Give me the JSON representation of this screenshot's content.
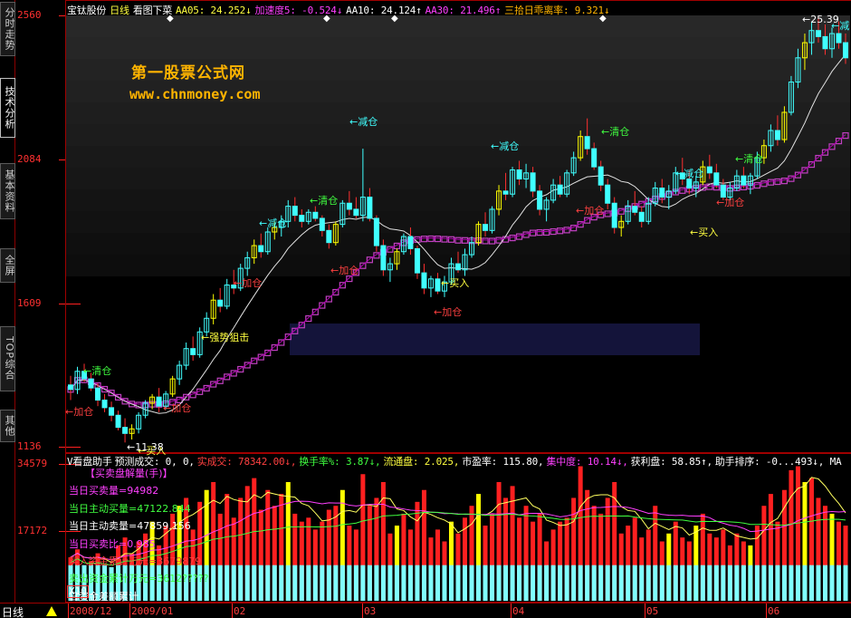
{
  "sidebar": {
    "tabs": [
      {
        "label": "分时走势",
        "active": false
      },
      {
        "label": "技术分析",
        "active": true
      },
      {
        "label": "基本资料",
        "active": false
      },
      {
        "label": "全屏",
        "active": false
      },
      {
        "label": "TOP综合",
        "active": false
      },
      {
        "label": "其他",
        "active": false
      }
    ]
  },
  "header": {
    "stock_name": "宝钛股份",
    "period": "日线",
    "indicator_name": "看图下菜",
    "items": [
      {
        "text": "AA05: 24.252↓",
        "color": "#ffff40"
      },
      {
        "text": "加速度5: -0.524↓",
        "color": "#ff40ff"
      },
      {
        "text": "AA10: 24.124↑",
        "color": "#ffffff"
      },
      {
        "text": "AA30: 21.496↑",
        "color": "#ff40ff"
      },
      {
        "text": "三拾日乖离率: 9.321↓",
        "color": "#ffb400"
      }
    ]
  },
  "watermark": {
    "line1": "第一股票公式网",
    "line2": "www.chnmoney.com"
  },
  "price_axis": {
    "labels": [
      "2560",
      "2084",
      "1609",
      "1136"
    ]
  },
  "volume_axis": {
    "labels": [
      "34579",
      "17172"
    ]
  },
  "annotations": [
    {
      "text": "←清仓",
      "color": "#40ff40"
    },
    {
      "text": "←加仓",
      "color": "#ff4040"
    },
    {
      "text": "←加仓",
      "color": "#ff4040"
    },
    {
      "text": "←买入",
      "color": "#ffff40"
    },
    {
      "text": "←强势狙击",
      "color": "#ffff40"
    },
    {
      "text": "←加仓",
      "color": "#ff4040"
    },
    {
      "text": "←减仓",
      "color": "#40ffff"
    },
    {
      "text": "←清仓",
      "color": "#40ff40"
    },
    {
      "text": "←加仓",
      "color": "#ff4040"
    },
    {
      "text": "←减仓",
      "color": "#40ffff"
    },
    {
      "text": "←买入",
      "color": "#ffff40"
    },
    {
      "text": "←加仓",
      "color": "#ff4040"
    },
    {
      "text": "←减仓",
      "color": "#40ffff"
    },
    {
      "text": "←清仓",
      "color": "#40ff40"
    },
    {
      "text": "←加仓",
      "color": "#ff4040"
    },
    {
      "text": "←减仓",
      "color": "#40ffff"
    },
    {
      "text": "←清仓",
      "color": "#40ff40"
    },
    {
      "text": "←加仓",
      "color": "#ff4040"
    },
    {
      "text": "←买入",
      "color": "#ffff40"
    },
    {
      "text": "←25.39",
      "color": "#ffffff"
    },
    {
      "text": "←减",
      "color": "#40ffff"
    },
    {
      "text": "←11.38",
      "color": "#ffffff"
    }
  ],
  "volume_header": {
    "title": "V看盘助手",
    "items": [
      {
        "text": "预测成交: 0, 0,",
        "color": "#ffffff"
      },
      {
        "text": "实成交: 78342.00↓,",
        "color": "#ff4040"
      },
      {
        "text": "换手率%: 3.87↓,",
        "color": "#40ff40"
      },
      {
        "text": "流通盘: 2.025,",
        "color": "#ffff40"
      },
      {
        "text": "市盈率: 115.80,",
        "color": "#ffffff"
      },
      {
        "text": "集中度: 10.14↓,",
        "color": "#ff40ff"
      },
      {
        "text": "获利盘: 58.85↑,",
        "color": "#ffffff"
      },
      {
        "text": "助手排序: -0...493↓, MA",
        "color": "#ffffff"
      }
    ]
  },
  "info_panel": {
    "title": "【买卖盘解量(手)】",
    "lines": [
      {
        "text": "当日买卖量=94982",
        "color": "#ff40ff"
      },
      {
        "text": "当日主动买量=47122.844",
        "color": "#40ff40"
      },
      {
        "text": "当日主动卖量=47859.156",
        "color": "#ffffff"
      },
      {
        "text": "当日买卖比=0.985",
        "color": "#ff40ff"
      },
      {
        "text": "买入资金累计万元=3679879",
        "color": "#ff4040"
      },
      {
        "text": "卖出资金累计万元=3612?????",
        "color": "#40ff40"
      },
      {
        "text": "日资金差额累计",
        "color": "#ffffff"
      }
    ]
  },
  "volume_scale": "X10",
  "timeline": {
    "period_label": "日线",
    "labels": [
      "2008/12",
      "2009/01",
      "02",
      "03",
      "04",
      "05",
      "06"
    ]
  },
  "chart_data": {
    "type": "candlestick",
    "price_range": [
      1136,
      2560
    ],
    "volume_range": [
      0,
      34579
    ],
    "candles": [
      [
        1340,
        1370,
        1290,
        1325,
        1
      ],
      [
        1325,
        1400,
        1310,
        1385,
        0
      ],
      [
        1385,
        1410,
        1350,
        1360,
        1
      ],
      [
        1360,
        1380,
        1320,
        1330,
        1
      ],
      [
        1330,
        1345,
        1270,
        1290,
        1
      ],
      [
        1290,
        1310,
        1250,
        1265,
        1
      ],
      [
        1265,
        1285,
        1220,
        1240,
        1
      ],
      [
        1240,
        1255,
        1190,
        1200,
        1
      ],
      [
        1200,
        1230,
        1150,
        1180,
        0
      ],
      [
        1180,
        1210,
        1160,
        1195,
        0
      ],
      [
        1195,
        1250,
        1180,
        1240,
        0
      ],
      [
        1240,
        1290,
        1230,
        1280,
        0
      ],
      [
        1280,
        1310,
        1260,
        1300,
        0
      ],
      [
        1300,
        1330,
        1250,
        1270,
        1
      ],
      [
        1270,
        1320,
        1260,
        1310,
        0
      ],
      [
        1310,
        1370,
        1300,
        1360,
        0
      ],
      [
        1360,
        1420,
        1340,
        1405,
        0
      ],
      [
        1405,
        1480,
        1390,
        1460,
        0
      ],
      [
        1460,
        1500,
        1420,
        1440,
        1
      ],
      [
        1440,
        1530,
        1430,
        1515,
        0
      ],
      [
        1515,
        1580,
        1500,
        1560,
        0
      ],
      [
        1560,
        1640,
        1540,
        1620,
        0
      ],
      [
        1620,
        1660,
        1580,
        1600,
        1
      ],
      [
        1600,
        1690,
        1590,
        1670,
        0
      ],
      [
        1670,
        1720,
        1640,
        1660,
        1
      ],
      [
        1660,
        1740,
        1650,
        1725,
        0
      ],
      [
        1725,
        1780,
        1700,
        1760,
        0
      ],
      [
        1760,
        1820,
        1740,
        1800,
        0
      ],
      [
        1800,
        1840,
        1760,
        1780,
        1
      ],
      [
        1780,
        1860,
        1770,
        1845,
        0
      ],
      [
        1845,
        1880,
        1820,
        1860,
        0
      ],
      [
        1860,
        1900,
        1830,
        1880,
        0
      ],
      [
        1880,
        1950,
        1860,
        1930,
        0
      ],
      [
        1930,
        1960,
        1880,
        1900,
        1
      ],
      [
        1900,
        1920,
        1860,
        1880,
        1
      ],
      [
        1880,
        1920,
        1870,
        1910,
        0
      ],
      [
        1910,
        1930,
        1880,
        1890,
        1
      ],
      [
        1890,
        1900,
        1830,
        1850,
        1
      ],
      [
        1850,
        1870,
        1790,
        1810,
        1
      ],
      [
        1810,
        1880,
        1800,
        1870,
        0
      ],
      [
        1870,
        1950,
        1860,
        1940,
        0
      ],
      [
        1940,
        1980,
        1900,
        1920,
        1
      ],
      [
        1920,
        1960,
        1890,
        1900,
        1
      ],
      [
        1900,
        2120,
        1880,
        1960,
        0
      ],
      [
        1960,
        1990,
        1880,
        1890,
        1
      ],
      [
        1890,
        1900,
        1780,
        1800,
        1
      ],
      [
        1800,
        1820,
        1700,
        1720,
        1
      ],
      [
        1720,
        1760,
        1680,
        1740,
        0
      ],
      [
        1740,
        1790,
        1720,
        1780,
        0
      ],
      [
        1780,
        1840,
        1770,
        1830,
        0
      ],
      [
        1830,
        1860,
        1770,
        1790,
        1
      ],
      [
        1790,
        1800,
        1690,
        1710,
        1
      ],
      [
        1710,
        1740,
        1640,
        1660,
        1
      ],
      [
        1660,
        1700,
        1630,
        1690,
        0
      ],
      [
        1690,
        1710,
        1640,
        1650,
        1
      ],
      [
        1650,
        1700,
        1630,
        1680,
        0
      ],
      [
        1680,
        1760,
        1670,
        1740,
        0
      ],
      [
        1740,
        1780,
        1710,
        1720,
        1
      ],
      [
        1720,
        1790,
        1700,
        1770,
        0
      ],
      [
        1770,
        1830,
        1760,
        1810,
        0
      ],
      [
        1810,
        1880,
        1800,
        1870,
        0
      ],
      [
        1870,
        1910,
        1830,
        1850,
        1
      ],
      [
        1850,
        1930,
        1840,
        1920,
        0
      ],
      [
        1920,
        2000,
        1900,
        1980,
        0
      ],
      [
        1980,
        2040,
        1950,
        1970,
        1
      ],
      [
        1970,
        2060,
        1960,
        2050,
        0
      ],
      [
        2050,
        2080,
        2000,
        2020,
        1
      ],
      [
        2020,
        2070,
        1990,
        2040,
        0
      ],
      [
        2040,
        2060,
        1960,
        1980,
        1
      ],
      [
        1980,
        2000,
        1900,
        1920,
        1
      ],
      [
        1920,
        1960,
        1880,
        1950,
        0
      ],
      [
        1950,
        2020,
        1940,
        2000,
        0
      ],
      [
        2000,
        2030,
        1960,
        1970,
        1
      ],
      [
        1970,
        2050,
        1960,
        2040,
        0
      ],
      [
        2040,
        2110,
        2030,
        2090,
        0
      ],
      [
        2090,
        2180,
        2080,
        2160,
        0
      ],
      [
        2160,
        2220,
        2100,
        2120,
        1
      ],
      [
        2120,
        2140,
        2050,
        2060,
        1
      ],
      [
        2060,
        2080,
        1980,
        2000,
        1
      ],
      [
        2000,
        2020,
        1920,
        1940,
        1
      ],
      [
        1940,
        1960,
        1840,
        1860,
        1
      ],
      [
        1860,
        1900,
        1830,
        1880,
        0
      ],
      [
        1880,
        1950,
        1870,
        1930,
        0
      ],
      [
        1930,
        1980,
        1900,
        1910,
        1
      ],
      [
        1910,
        1930,
        1860,
        1880,
        1
      ],
      [
        1880,
        1960,
        1870,
        1940,
        0
      ],
      [
        1940,
        2010,
        1930,
        1990,
        0
      ],
      [
        1990,
        2020,
        1940,
        1960,
        1
      ],
      [
        1960,
        2000,
        1920,
        1980,
        0
      ],
      [
        1980,
        2060,
        1970,
        2040,
        0
      ],
      [
        2040,
        2090,
        2000,
        2020,
        1
      ],
      [
        2020,
        2050,
        1970,
        1990,
        1
      ],
      [
        1990,
        2030,
        1960,
        2010,
        0
      ],
      [
        2010,
        2080,
        2000,
        2060,
        0
      ],
      [
        2060,
        2100,
        2020,
        2040,
        1
      ],
      [
        2040,
        2070,
        1990,
        2000,
        1
      ],
      [
        2000,
        2020,
        1950,
        1960,
        1
      ],
      [
        1960,
        2010,
        1950,
        1990,
        0
      ],
      [
        1990,
        2050,
        1980,
        2030,
        0
      ],
      [
        2030,
        2060,
        1990,
        2000,
        1
      ],
      [
        2000,
        2040,
        1970,
        2030,
        0
      ],
      [
        2030,
        2110,
        2020,
        2090,
        0
      ],
      [
        2090,
        2150,
        2070,
        2130,
        0
      ],
      [
        2130,
        2200,
        2110,
        2180,
        0
      ],
      [
        2180,
        2230,
        2130,
        2150,
        1
      ],
      [
        2150,
        2260,
        2140,
        2240,
        0
      ],
      [
        2240,
        2360,
        2230,
        2340,
        0
      ],
      [
        2340,
        2450,
        2320,
        2420,
        0
      ],
      [
        2420,
        2500,
        2380,
        2470,
        0
      ],
      [
        2470,
        2540,
        2430,
        2510,
        0
      ],
      [
        2510,
        2560,
        2470,
        2490,
        1
      ],
      [
        2490,
        2530,
        2430,
        2450,
        1
      ],
      [
        2450,
        2520,
        2420,
        2500,
        0
      ],
      [
        2500,
        2540,
        2450,
        2470,
        1
      ],
      [
        2470,
        2500,
        2400,
        2420,
        1
      ]
    ],
    "volumes": [
      11000,
      13000,
      9000,
      10000,
      12000,
      9000,
      8500,
      14000,
      16000,
      12000,
      15000,
      17000,
      20000,
      14000,
      19000,
      22000,
      24000,
      26000,
      18000,
      25000,
      28000,
      30000,
      22000,
      27000,
      21000,
      26000,
      29000,
      31000,
      23000,
      28000,
      24000,
      27000,
      30000,
      22000,
      20000,
      21000,
      18000,
      20000,
      23000,
      24000,
      28000,
      19000,
      18000,
      32000,
      24000,
      26000,
      30000,
      17000,
      19000,
      22000,
      18000,
      25000,
      28000,
      16000,
      18000,
      15000,
      20000,
      17000,
      21000,
      24000,
      27000,
      19000,
      22000,
      30000,
      26000,
      29000,
      21000,
      24000,
      20000,
      22000,
      15000,
      18000,
      20000,
      21000,
      26000,
      34000,
      28000,
      24000,
      22000,
      26000,
      30000,
      17000,
      19000,
      21000,
      16000,
      18000,
      24000,
      15000,
      17000,
      20000,
      16000,
      15000,
      19000,
      22000,
      17000,
      16000,
      18000,
      14000,
      17000,
      15000,
      14000,
      19000,
      24000,
      27000,
      20000,
      28000,
      33000,
      34000,
      30000,
      31000,
      26000,
      24000,
      22000,
      20000,
      19000
    ]
  }
}
